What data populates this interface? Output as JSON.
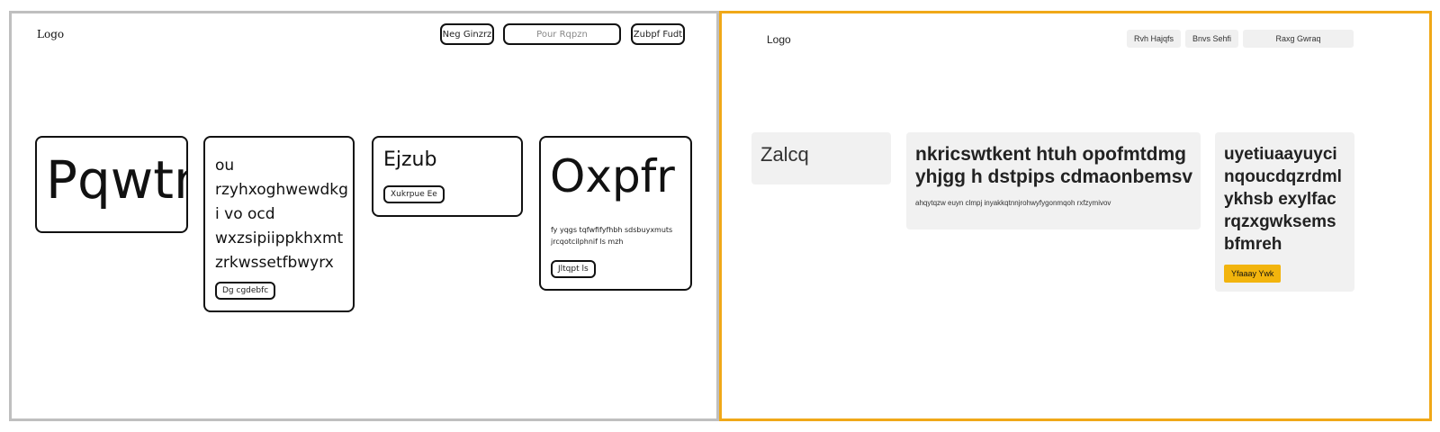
{
  "sketch": {
    "logo": "Logo",
    "nav_button_1": "Neg Ginzrz",
    "search_field": "Pour Rqpzn",
    "nav_button_2": "Zubpf Fudt",
    "card1": {
      "title": "Pqwtn"
    },
    "card2": {
      "text_lines": [
        "ou",
        "rzyhxoghwewdkg",
        "i vo ocd",
        "wxzsipiippkhxmt",
        "zrkwssetfbwyrx"
      ],
      "button": "Dg cgdebfc"
    },
    "card3": {
      "title": "Ejzub",
      "button": "Xukrpue Ee"
    },
    "card4": {
      "title": "Oxpfr",
      "caption_lines": [
        "fy yqgs tqfwfifyfhbh sdsbuyxmuts",
        "jrcqotcilphnif ls mzh"
      ],
      "button": "Jltqpt ls"
    }
  },
  "polished": {
    "logo": "Logo",
    "nav_buttons": [
      "Rvh Hajqfs",
      "Bnvs Sehfi",
      "Raxg Gwraq"
    ],
    "card1": {
      "title": "Zalcq"
    },
    "card2": {
      "title_lines": [
        "nkricswtkent htuh opofmtdmg",
        "yhjgg h dstpips cdmaonbemsv"
      ],
      "body": "ahqytqzw euyn clmpj inyakkqtnnjrohwyfygonmqoh rxfzymivov"
    },
    "card3": {
      "title_lines": [
        "uyetiuaayuyci",
        "nqoucdqzrdml",
        "ykhsb exylfac",
        "rqzxgwksems",
        "bfmreh"
      ],
      "button": "Yfaaay Ywk"
    },
    "colors": {
      "accent": "#f2b40d",
      "frame_border": "#f0a818",
      "card_bg": "#f1f1f1"
    }
  }
}
